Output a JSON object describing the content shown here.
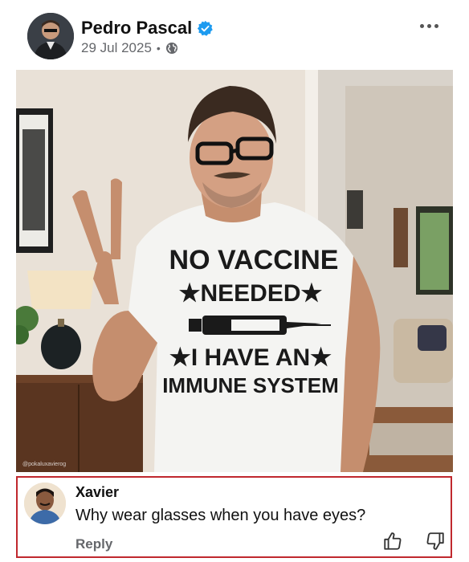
{
  "post": {
    "author_name": "Pedro Pascal",
    "date": "29 Jul 2025",
    "separator": "•",
    "more_icon": "more-horizontal-icon",
    "verified_icon": "verified-badge-icon",
    "audience_icon": "globe-icon",
    "verified_color": "#1d9bf0"
  },
  "photo": {
    "shirt_line1": "NO VACCINE",
    "shirt_line2": "★NEEDED★",
    "shirt_line3": "★I HAVE AN★",
    "shirt_line4": "IMMUNE SYSTEM",
    "watermark": "@pokaluxavierog"
  },
  "comment": {
    "author": "Xavier",
    "text": "Why wear glasses when you have eyes?",
    "reply_label": "Reply",
    "like_icon": "thumbs-up-icon",
    "dislike_icon": "thumbs-down-icon",
    "highlight_color": "#c0282e"
  }
}
